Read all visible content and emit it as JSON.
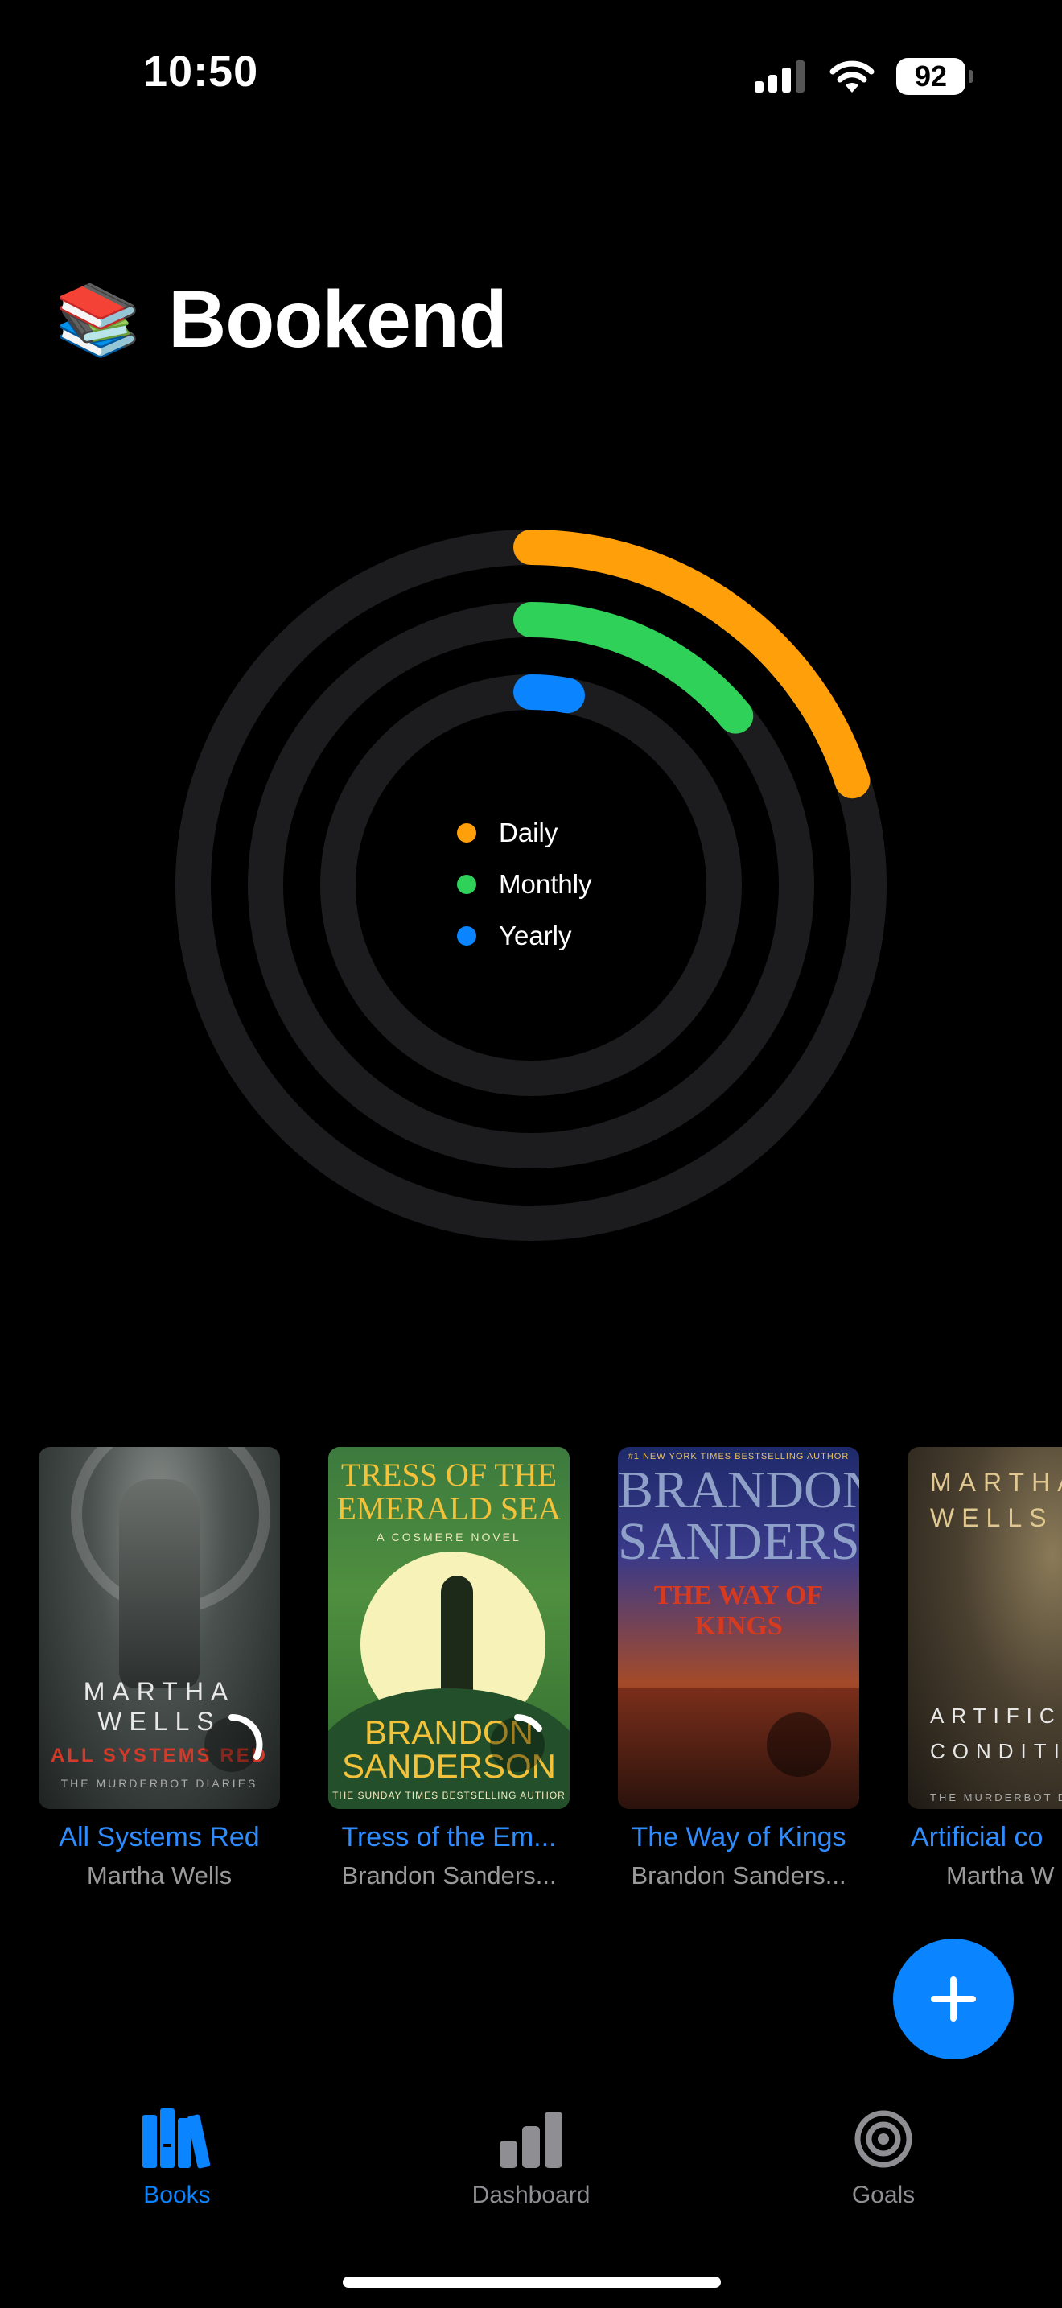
{
  "status_bar": {
    "time": "10:50",
    "battery": "92"
  },
  "header": {
    "title": "Bookend",
    "emoji": "📚"
  },
  "rings": {
    "legend": [
      {
        "label": "Daily",
        "color": "#ff9f0a"
      },
      {
        "label": "Monthly",
        "color": "#30d158"
      },
      {
        "label": "Yearly",
        "color": "#0a84ff"
      }
    ],
    "progress": {
      "daily": 0.2,
      "monthly": 0.14,
      "yearly": 0.03
    }
  },
  "books": [
    {
      "title": "All Systems Red",
      "author": "Martha Wells",
      "cover_author": "MARTHA WELLS",
      "cover_title": "ALL SYSTEMS RED",
      "cover_sub": "THE MURDERBOT DIARIES"
    },
    {
      "title": "Tress of the Em...",
      "author": "Brandon Sanders...",
      "cover_title_1": "TRESS OF THE",
      "cover_title_2": "EMERALD SEA",
      "cover_note": "A COSMERE NOVEL",
      "cover_author_1": "BRANDON",
      "cover_author_2": "SANDERSON",
      "cover_sub": "THE SUNDAY TIMES BESTSELLING AUTHOR"
    },
    {
      "title": "The Way of Kings",
      "author": "Brandon Sanders...",
      "cover_top": "#1 NEW YORK TIMES BESTSELLING AUTHOR",
      "cover_author_1": "BRANDON",
      "cover_author_2": "SANDERSON",
      "cover_title": "THE WAY OF KINGS"
    },
    {
      "title": "Artificial co",
      "author": "Martha W",
      "cover_author": "MARTHA WELLS",
      "cover_title": "ARTIFICIAL CONDITION",
      "cover_sub": "THE MURDERBOT DIARIES"
    }
  ],
  "tabs": [
    {
      "label": "Books",
      "active": true
    },
    {
      "label": "Dashboard",
      "active": false
    },
    {
      "label": "Goals",
      "active": false
    }
  ]
}
